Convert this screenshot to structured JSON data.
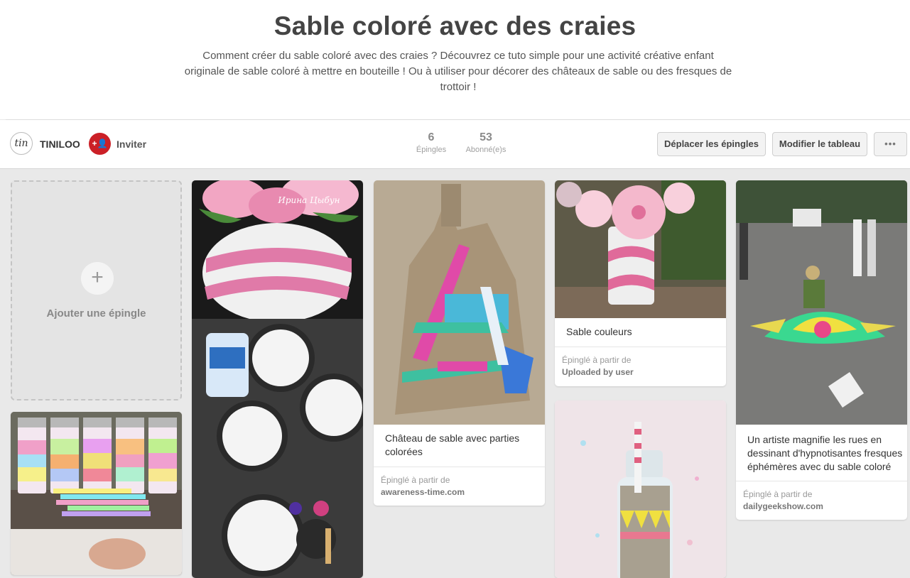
{
  "board": {
    "title": "Sable coloré avec des craies",
    "description_lines": [
      "Comment créer du sable coloré avec des craies ? Découvrez ce tuto simple pour une activité créative enfant",
      "originale de sable coloré à mettre en bouteille ! Ou à utiliser pour décorer des châteaux de sable ou des fresques de",
      "trottoir !"
    ]
  },
  "toolbar": {
    "logo_text": "tin",
    "owner": "TINILOO",
    "invite_icon_text": "+👤",
    "invite_label": "Inviter",
    "stats": [
      {
        "value": "6",
        "label": "Épingles"
      },
      {
        "value": "53",
        "label": "Abonné(e)s"
      }
    ],
    "move_pins_label": "Déplacer les épingles",
    "edit_board_label": "Modifier le tableau",
    "more_label": "•••"
  },
  "add_pin": {
    "plus": "+",
    "label": "Ajouter une épingle"
  },
  "pins": {
    "image_watermark": "Ирина Цыбун",
    "sandcastle": {
      "title_lines": [
        "Château de sable avec parties",
        "colorées"
      ],
      "source_label": "Épinglé à partir de",
      "source": "awareness-time.com"
    },
    "sable": {
      "title": "Sable couleurs",
      "source_label": "Épinglé à partir de",
      "source": "Uploaded by user"
    },
    "artist": {
      "title_lines": [
        "Un artiste magnifie les rues en",
        "dessinant d'hypnotisantes fresques",
        "éphémères avec du sable coloré"
      ],
      "source_label": "Épinglé à partir de",
      "source": "dailygeekshow.com"
    }
  },
  "colors": {
    "accent_red": "#cb2027",
    "background": "#e9e9e9"
  }
}
